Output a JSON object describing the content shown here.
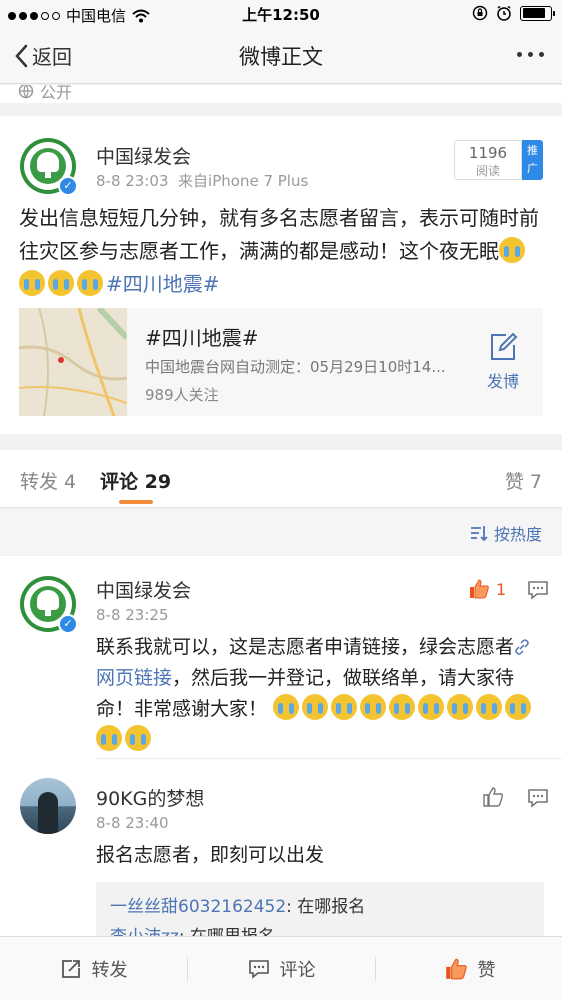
{
  "status_bar": {
    "carrier": "中国电信",
    "time": "上午12:50"
  },
  "nav": {
    "back_label": "返回",
    "title": "微博正文"
  },
  "visibility": {
    "label": "公开"
  },
  "post": {
    "author": "中国绿发会",
    "time": "8-8 23:03",
    "source": "来自iPhone 7 Plus",
    "read_count": "1196",
    "read_label": "阅读",
    "promo_label": "推广",
    "text": "发出信息短短几分钟，就有多名志愿者留言，表示可随时前往灾区参与志愿者工作，满满的都是感动！这个夜无眠",
    "hashtag": "#四川地震#",
    "topic": {
      "title": "#四川地震#",
      "desc": "中国地震台网自动测定：05月29日10时14...",
      "followers": "989人关注",
      "action_label": "发博"
    }
  },
  "tabs": {
    "repost": "转发 4",
    "comment_label": "评论",
    "comment_count": "29",
    "like": "赞 7"
  },
  "sort": {
    "label": "按热度"
  },
  "comments": [
    {
      "author": "中国绿发会",
      "time": "8-8 23:25",
      "likes": "1",
      "text_part1": "联系我就可以，这是志愿者申请链接，绿会志愿者",
      "link": "网页链接",
      "text_part2": "，然后我一并登记，做联络单，请大家待命！非常感谢大家！"
    },
    {
      "author": "90KG的梦想",
      "time": "8-8 23:40",
      "text": "报名志愿者，即刻可以出发",
      "replies": [
        {
          "user": "一丝丝甜6032162452",
          "text": ": 在哪报名"
        },
        {
          "user": "李小沛zz",
          "text": ": 在哪里报名"
        }
      ]
    }
  ],
  "bottom_bar": {
    "repost": "转发",
    "comment": "评论",
    "like": "赞"
  },
  "colors": {
    "link": "#4d75b5",
    "accent": "#f28c3a",
    "like": "#e8541e",
    "verified": "#2e8ae6"
  }
}
